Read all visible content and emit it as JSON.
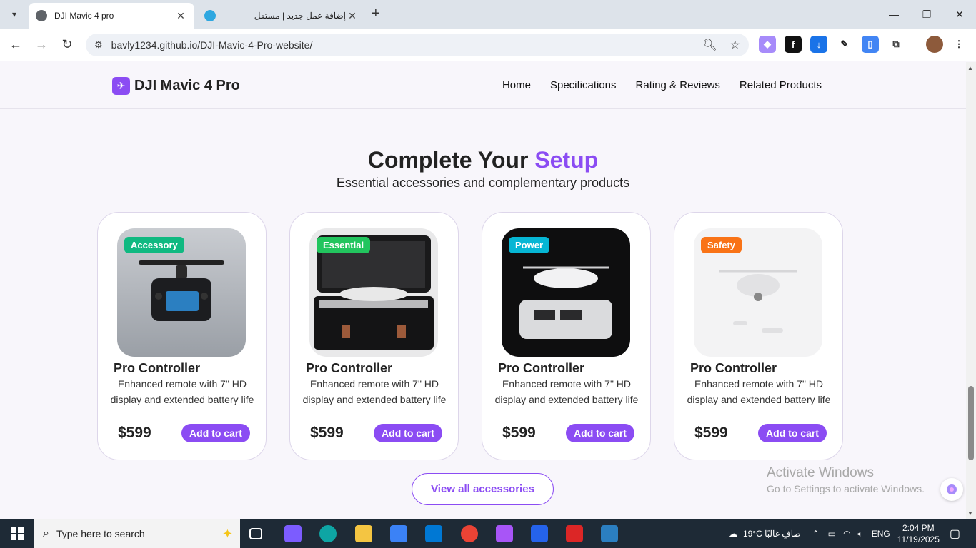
{
  "browser": {
    "tabs": [
      {
        "title": "DJI Mavic 4 pro",
        "active": true
      },
      {
        "title": "إضافة عمل جديد | مستقل",
        "active": false
      }
    ],
    "url": "bavly1234.github.io/DJI-Mavic-4-Pro-website/"
  },
  "header": {
    "logo_text": "DJI Mavic 4 Pro",
    "nav": [
      "Home",
      "Specifications",
      "Rating & Reviews",
      "Related Products"
    ]
  },
  "section": {
    "title_main": "Complete Your ",
    "title_accent": "Setup",
    "subtitle": "Essential accessories and complementary products"
  },
  "products": [
    {
      "badge": "Accessory",
      "badge_color": "#10b981",
      "name": "Pro Controller",
      "desc": "Enhanced remote with 7\" HD display and extended battery life",
      "price": "$599",
      "cta": "Add to cart"
    },
    {
      "badge": "Essential",
      "badge_color": "#22c55e",
      "name": "Pro Controller",
      "desc": "Enhanced remote with 7\" HD display and extended battery life",
      "price": "$599",
      "cta": "Add to cart"
    },
    {
      "badge": "Power",
      "badge_color": "#06b6d4",
      "name": "Pro Controller",
      "desc": "Enhanced remote with 7\" HD display and extended battery life",
      "price": "$599",
      "cta": "Add to cart"
    },
    {
      "badge": "Safety",
      "badge_color": "#f97316",
      "name": "Pro Controller",
      "desc": "Enhanced remote with 7\" HD display and extended battery life",
      "price": "$599",
      "cta": "Add to cart"
    }
  ],
  "view_all": "View all accessories",
  "activation": {
    "line1": "Activate Windows",
    "line2": "Go to Settings to activate Windows."
  },
  "taskbar": {
    "search_placeholder": "Type here to search",
    "weather": "19°C  صافٍ غالبًا",
    "lang": "ENG",
    "time": "2:04 PM",
    "date": "11/19/2025"
  },
  "colors": {
    "accent": "#8b4cf3"
  }
}
